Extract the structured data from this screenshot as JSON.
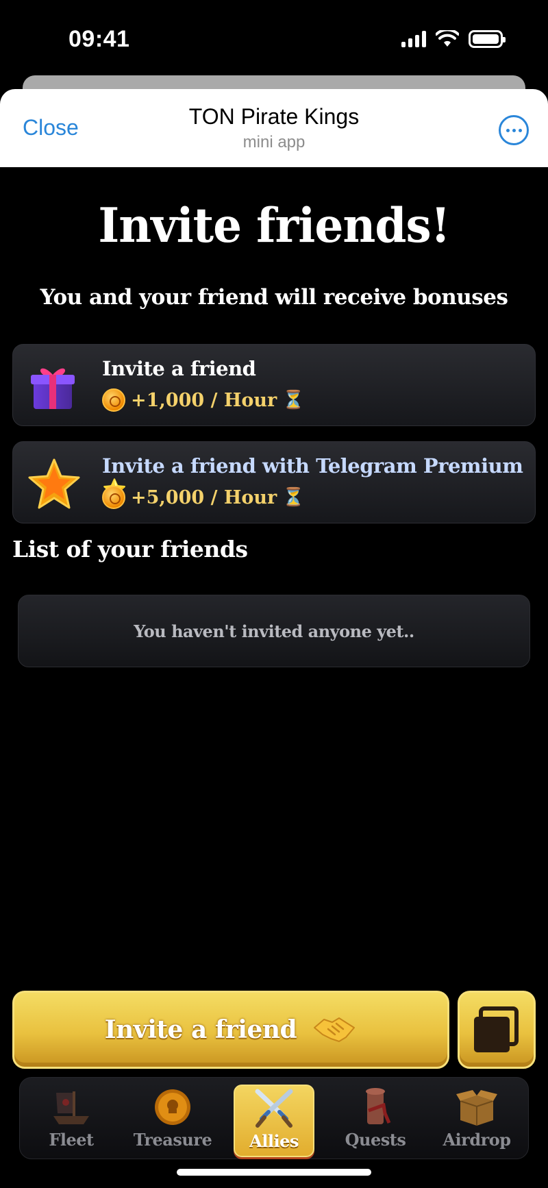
{
  "status_bar": {
    "time": "09:41"
  },
  "telegram_header": {
    "close_label": "Close",
    "title": "TON Pirate Kings",
    "subtitle": "mini app"
  },
  "main": {
    "title": "Invite friends!",
    "subtitle": "You and your friend will receive bonuses",
    "cards": [
      {
        "title": "Invite a friend",
        "reward": "+1,000 / Hour",
        "icon": "gift-icon"
      },
      {
        "title": "Invite a friend with Telegram Premium ⭐",
        "reward": "+5,000 / Hour",
        "icon": "star-icon"
      }
    ],
    "friends_section_title": "List of your friends",
    "empty_message": "You haven't invited anyone yet.."
  },
  "actions": {
    "invite_button_label": "Invite a friend",
    "invite_icon": "handshake-icon",
    "copy_icon": "copy-icon"
  },
  "bottom_nav": {
    "items": [
      {
        "label": "Fleet",
        "icon": "ship-icon"
      },
      {
        "label": "Treasure",
        "icon": "coin-icon"
      },
      {
        "label": "Allies",
        "icon": "crossed-swords-icon",
        "active": true
      },
      {
        "label": "Quests",
        "icon": "scroll-icon"
      },
      {
        "label": "Airdrop",
        "icon": "box-icon"
      }
    ]
  },
  "colors": {
    "accent_gold": "#e9c13f",
    "telegram_blue": "#2a86d9",
    "reward_text": "#f4d16b",
    "premium_text": "#c6d9ff"
  }
}
